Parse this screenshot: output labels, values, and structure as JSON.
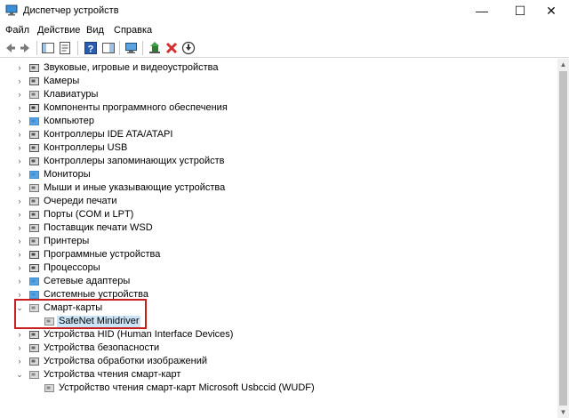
{
  "window": {
    "title": "Диспетчер устройств",
    "minimize_glyph": "—",
    "maximize_glyph": "☐",
    "close_glyph": "✕"
  },
  "menu": {
    "items": [
      "Файл",
      "Действие",
      "Вид",
      "Справка"
    ]
  },
  "toolbar": {
    "icons": [
      "back-icon",
      "forward-icon",
      "show-hide-console-tree-icon",
      "properties-icon",
      "help-icon",
      "action-pane-icon",
      "scan-hardware-icon",
      "update-driver-icon",
      "uninstall-icon",
      "download-icon"
    ]
  },
  "tree": {
    "items": [
      {
        "label": "Звуковые, игровые и видеоустройства",
        "expanded": false,
        "icon": "speaker-icon"
      },
      {
        "label": "Камеры",
        "expanded": false,
        "icon": "camera-icon"
      },
      {
        "label": "Клавиатуры",
        "expanded": false,
        "icon": "keyboard-icon"
      },
      {
        "label": "Компоненты программного обеспечения",
        "expanded": false,
        "icon": "software-component-icon"
      },
      {
        "label": "Компьютер",
        "expanded": false,
        "icon": "computer-icon"
      },
      {
        "label": "Контроллеры IDE ATA/ATAPI",
        "expanded": false,
        "icon": "ide-controller-icon"
      },
      {
        "label": "Контроллеры USB",
        "expanded": false,
        "icon": "usb-icon"
      },
      {
        "label": "Контроллеры запоминающих устройств",
        "expanded": false,
        "icon": "storage-controller-icon"
      },
      {
        "label": "Мониторы",
        "expanded": false,
        "icon": "monitor-icon"
      },
      {
        "label": "Мыши и иные указывающие устройства",
        "expanded": false,
        "icon": "mouse-icon"
      },
      {
        "label": "Очереди печати",
        "expanded": false,
        "icon": "print-queue-icon"
      },
      {
        "label": "Порты (COM и LPT)",
        "expanded": false,
        "icon": "port-icon"
      },
      {
        "label": "Поставщик печати WSD",
        "expanded": false,
        "icon": "wsd-printer-icon"
      },
      {
        "label": "Принтеры",
        "expanded": false,
        "icon": "printer-icon"
      },
      {
        "label": "Программные устройства",
        "expanded": false,
        "icon": "software-device-icon"
      },
      {
        "label": "Процессоры",
        "expanded": false,
        "icon": "processor-icon"
      },
      {
        "label": "Сетевые адаптеры",
        "expanded": false,
        "icon": "network-adapter-icon"
      },
      {
        "label": "Системные устройства",
        "expanded": false,
        "icon": "system-device-icon"
      },
      {
        "label": "Смарт-карты",
        "expanded": true,
        "icon": "smart-card-icon"
      },
      {
        "label": "SafeNet Minidriver",
        "child": true,
        "selected": true,
        "icon": "smart-card-device-icon"
      },
      {
        "label": "Устройства HID (Human Interface Devices)",
        "expanded": false,
        "icon": "hid-icon"
      },
      {
        "label": "Устройства безопасности",
        "expanded": false,
        "icon": "security-device-icon"
      },
      {
        "label": "Устройства обработки изображений",
        "expanded": false,
        "icon": "imaging-device-icon"
      },
      {
        "label": "Устройства чтения смарт-карт",
        "expanded": true,
        "icon": "smart-card-reader-icon"
      },
      {
        "label": "Устройство чтения смарт-карт Microsoft Usbccid (WUDF)",
        "child": true,
        "selected": false,
        "icon": "smart-card-reader-device-icon"
      }
    ]
  },
  "colors": {
    "highlight_border": "#c81e1e",
    "selection_bg": "#cce4f7"
  }
}
